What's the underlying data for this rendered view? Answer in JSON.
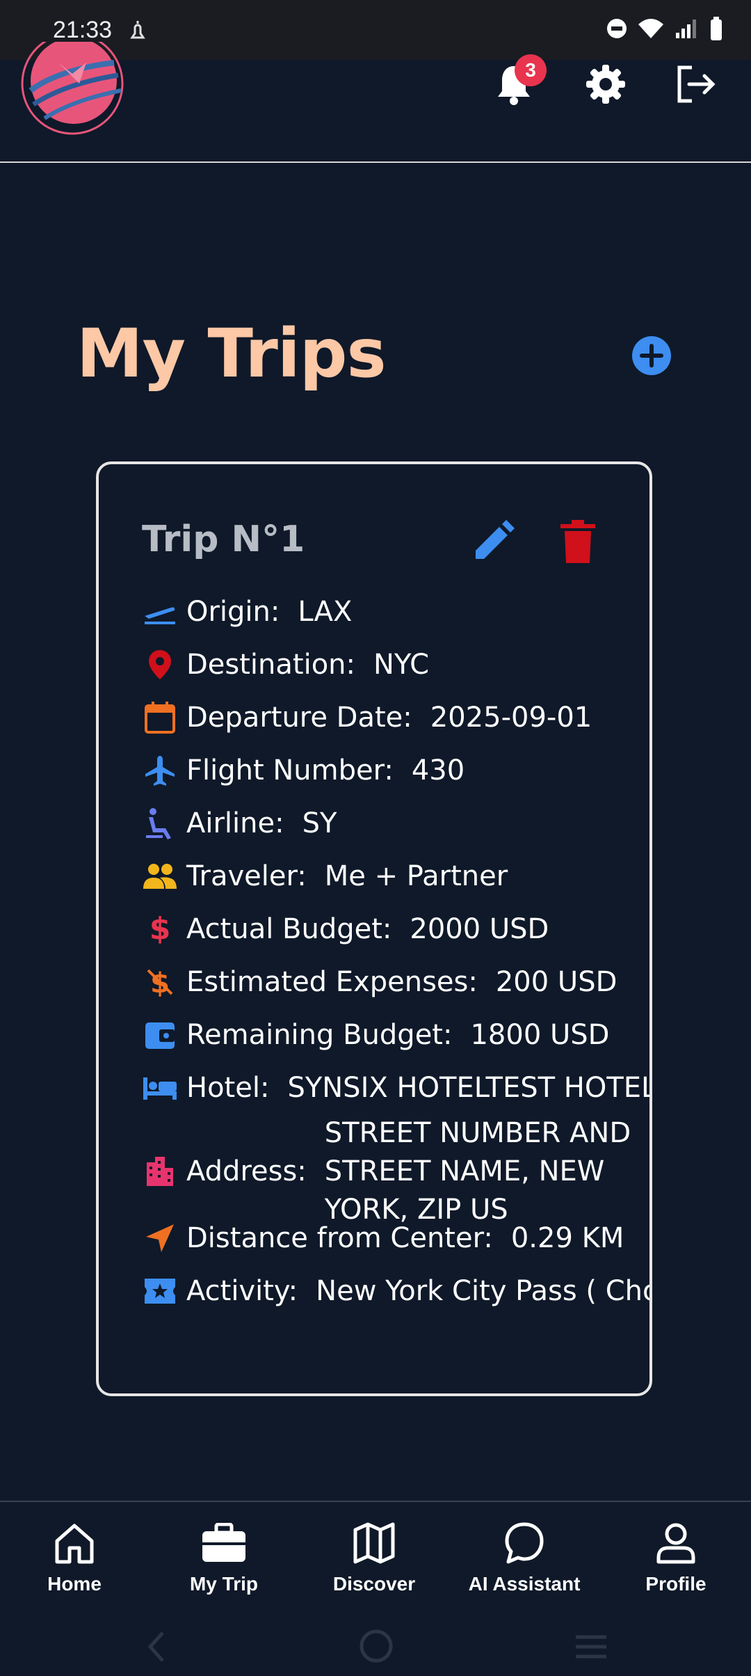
{
  "status_bar": {
    "time": "21:33"
  },
  "header": {
    "notification_count": "3"
  },
  "page": {
    "title": "My Trips"
  },
  "trip": {
    "title": "Trip N°1",
    "rows": [
      {
        "icon": "flight-takeoff-icon",
        "label": "Origin:",
        "value": "LAX"
      },
      {
        "icon": "location-pin-icon",
        "label": "Destination:",
        "value": "NYC"
      },
      {
        "icon": "calendar-icon",
        "label": "Departure Date:",
        "value": "2025-09-01"
      },
      {
        "icon": "airplane-icon",
        "label": "Flight Number:",
        "value": "430"
      },
      {
        "icon": "airline-seat-icon",
        "label": "Airline:",
        "value": "SY"
      },
      {
        "icon": "people-icon",
        "label": "Traveler:",
        "value": "Me + Partner"
      },
      {
        "icon": "dollar-icon",
        "label": "Actual Budget:",
        "value": "2000 USD"
      },
      {
        "icon": "money-off-icon",
        "label": "Estimated Expenses:",
        "value": "200 USD"
      },
      {
        "icon": "wallet-icon",
        "label": "Remaining Budget:",
        "value": "1800 USD"
      },
      {
        "icon": "bed-icon",
        "label": "Hotel:",
        "value": "SYNSIX HOTELTEST HOTEL"
      },
      {
        "icon": "building-icon",
        "label": "Address:",
        "value": "STREET NUMBER AND STREET NAME, NEW YORK, ZIP US"
      },
      {
        "icon": "navigation-arrow-icon",
        "label": "Distance from Center:",
        "value": "0.29 KM"
      },
      {
        "icon": "ticket-star-icon",
        "label": "Activity:",
        "value": "New York City Pass ( Cho"
      }
    ]
  },
  "bottom_nav": [
    {
      "label": "Home",
      "icon": "home-icon"
    },
    {
      "label": "My Trip",
      "icon": "briefcase-icon"
    },
    {
      "label": "Discover",
      "icon": "map-icon"
    },
    {
      "label": "AI Assistant",
      "icon": "chat-bubble-icon"
    },
    {
      "label": "Profile",
      "icon": "person-icon"
    }
  ],
  "colors": {
    "background": "#0f1929",
    "title": "#fcc8a6",
    "accent_blue": "#3d8ef0",
    "delete_red": "#d0101a",
    "badge_red": "#e8344e"
  }
}
